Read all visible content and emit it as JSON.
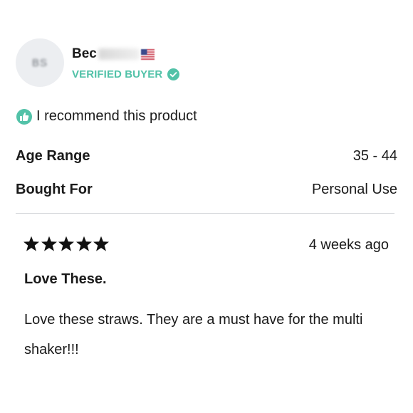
{
  "reviewer": {
    "initials": "BS",
    "name_visible": "Bec",
    "verified_label": "VERIFIED BUYER",
    "flag_icon": "us-flag-icon",
    "verified_icon": "check-circle-icon",
    "verified_color": "#52c2a8"
  },
  "recommendation": {
    "icon": "thumbs-up-icon",
    "text": "I recommend this product"
  },
  "attributes": [
    {
      "label": "Age Range",
      "value": "35 - 44"
    },
    {
      "label": "Bought For",
      "value": "Personal Use"
    }
  ],
  "review": {
    "rating": 5,
    "max_rating": 5,
    "date": "4 weeks ago",
    "title": "Love These.",
    "body": "Love these straws. They are a must have for the multi shaker!!!"
  }
}
